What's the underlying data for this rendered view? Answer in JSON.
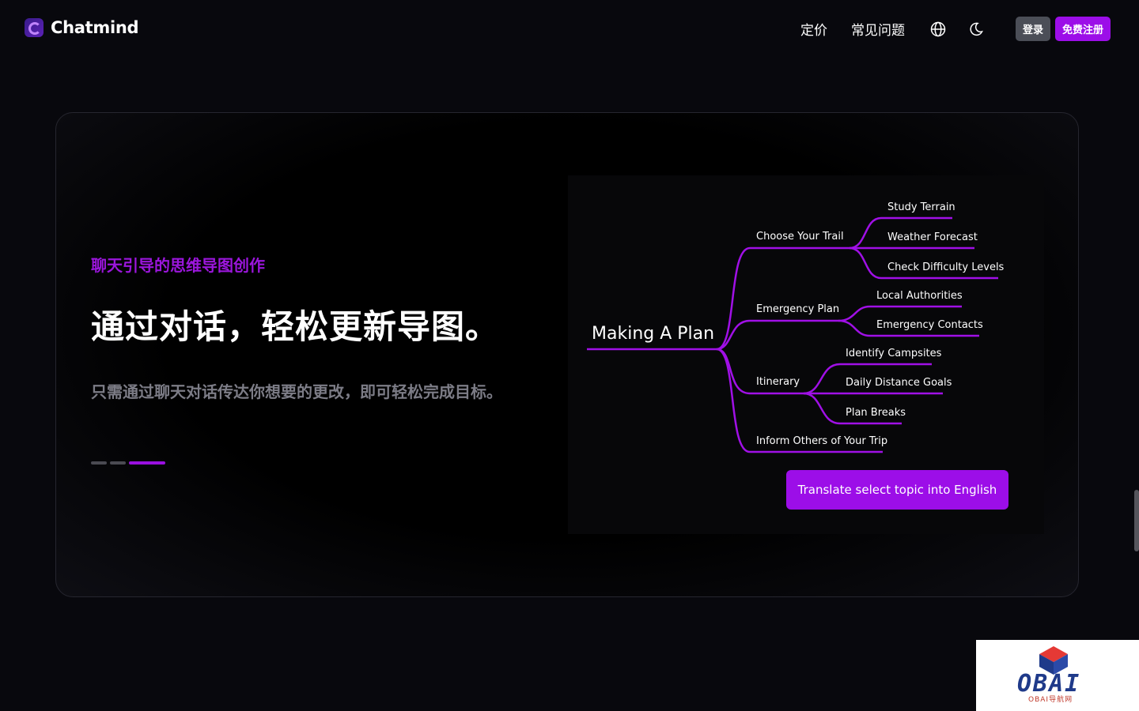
{
  "header": {
    "brand": "Chatmind",
    "nav": [
      "定价",
      "常见问题"
    ],
    "login_label": "登录",
    "signup_label": "免费注册"
  },
  "hero": {
    "subtitle": "聊天引导的思维导图创作",
    "headline": "通过对话，轻松更新导图。",
    "description": "只需通过聊天对话传达你想要的更改，即可轻松完成目标。",
    "slides_total": 3,
    "active_slide": 3
  },
  "mindmap": {
    "root": "Making A Plan",
    "branches": [
      {
        "label": "Choose Your Trail",
        "children": [
          "Study Terrain",
          "Weather Forecast",
          "Check Difficulty Levels"
        ]
      },
      {
        "label": "Emergency Plan",
        "children": [
          "Local Authorities",
          "Emergency Contacts"
        ]
      },
      {
        "label": "Itinerary",
        "children": [
          "Identify Campsites",
          "Daily Distance Goals",
          "Plan Breaks"
        ]
      },
      {
        "label": "Inform Others of Your Trip",
        "children": []
      }
    ],
    "action_label": "Translate select topic into English"
  },
  "colors": {
    "accent": "#9c0ee8",
    "background": "#08080d",
    "subtitle": "#9b16dc"
  },
  "icons": [
    "globe-icon",
    "moon-icon"
  ],
  "watermark": {
    "text": "OBAI",
    "sub": "OBAI导航网"
  }
}
